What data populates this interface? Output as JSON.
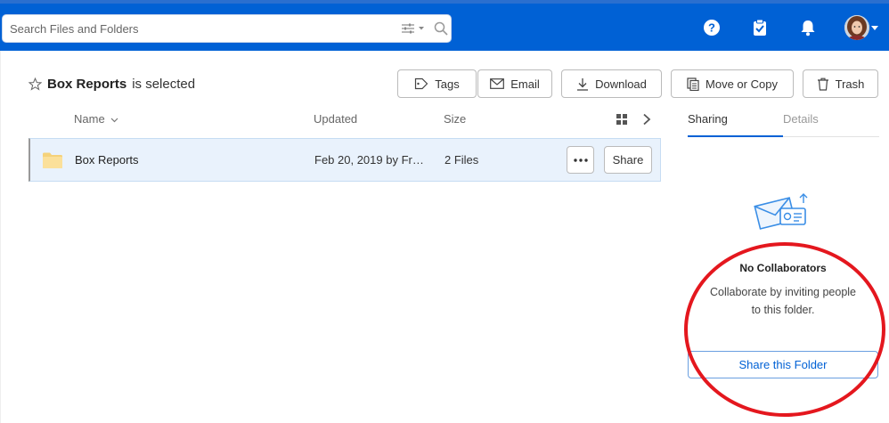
{
  "search": {
    "placeholder": "Search Files and Folders"
  },
  "header_icons": [
    "help-icon",
    "tasks-icon",
    "notification-bell-icon",
    "user-avatar"
  ],
  "selection": {
    "name": "Box Reports",
    "suffix": "is selected"
  },
  "toolbar": {
    "tags_label": "Tags",
    "email_label": "Email",
    "download_label": "Download",
    "move_label": "Move or Copy",
    "trash_label": "Trash"
  },
  "columns": {
    "name": "Name",
    "updated": "Updated",
    "size": "Size"
  },
  "rows": [
    {
      "name": "Box Reports",
      "updated": "Feb 20, 2019 by Fr…",
      "size": "2 Files",
      "share_label": "Share"
    }
  ],
  "sidebar": {
    "tabs": [
      {
        "label": "Sharing",
        "active": true
      },
      {
        "label": "Details",
        "active": false
      }
    ],
    "empty_title": "No Collaborators",
    "empty_line1": "Collaborate by inviting people",
    "empty_line2": "to this folder.",
    "share_button": "Share this Folder"
  },
  "colors": {
    "brand_blue": "#0061d5",
    "selected_row": "#e9f2fc",
    "annotation_red": "#e4171e"
  }
}
